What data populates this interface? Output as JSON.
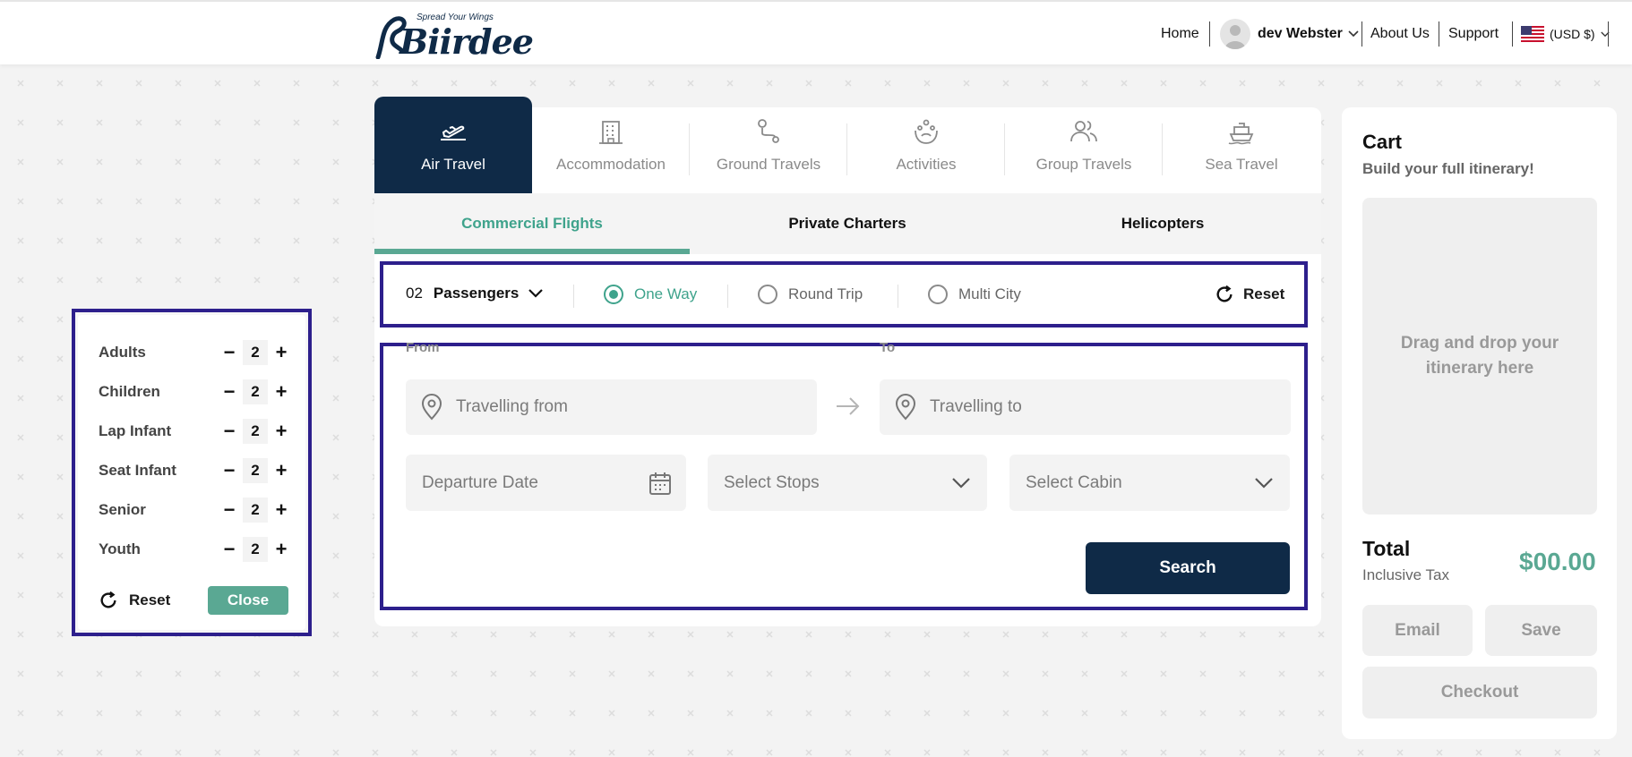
{
  "header": {
    "brand": {
      "name": "Biirdee",
      "tagline": "Spread Your Wings"
    },
    "nav": {
      "home": "Home",
      "user": "dev Webster",
      "about": "About Us",
      "support": "Support",
      "currency": "(USD $)"
    }
  },
  "tabs": [
    {
      "label": "Air Travel",
      "icon": "plane-icon",
      "active": true
    },
    {
      "label": "Accommodation",
      "icon": "building-icon",
      "active": false
    },
    {
      "label": "Ground Travels",
      "icon": "route-icon",
      "active": false
    },
    {
      "label": "Activities",
      "icon": "activities-icon",
      "active": false
    },
    {
      "label": "Group Travels",
      "icon": "group-icon",
      "active": false
    },
    {
      "label": "Sea Travel",
      "icon": "ship-icon",
      "active": false
    }
  ],
  "subtabs": [
    {
      "label": "Commercial Flights",
      "active": true
    },
    {
      "label": "Private Charters",
      "active": false
    },
    {
      "label": "Helicopters",
      "active": false
    }
  ],
  "trip": {
    "passenger_count": "02",
    "passenger_label": "Passengers",
    "options": [
      {
        "label": "One Way",
        "selected": true
      },
      {
        "label": "Round Trip",
        "selected": false
      },
      {
        "label": "Multi City",
        "selected": false
      }
    ],
    "reset": "Reset"
  },
  "form": {
    "from_label": "From",
    "to_label": "To",
    "from_placeholder": "Travelling from",
    "to_placeholder": "Travelling to",
    "departure": "Departure Date",
    "stops": "Select Stops",
    "cabin": "Select Cabin",
    "search": "Search"
  },
  "passengers_popup": {
    "rows": [
      {
        "label": "Adults",
        "value": "2"
      },
      {
        "label": "Children",
        "value": "2"
      },
      {
        "label": "Lap Infant",
        "value": "2"
      },
      {
        "label": "Seat Infant",
        "value": "2"
      },
      {
        "label": "Senior",
        "value": "2"
      },
      {
        "label": "Youth",
        "value": "2"
      }
    ],
    "reset": "Reset",
    "close": "Close"
  },
  "cart": {
    "title": "Cart",
    "subtitle": "Build your full itinerary!",
    "drop_text": "Drag and drop your itinerary here",
    "total_label": "Total",
    "tax_label": "Inclusive Tax",
    "amount": "$00.00",
    "email": "Email",
    "save": "Save",
    "checkout": "Checkout"
  },
  "colors": {
    "navy": "#0f2a47",
    "teal": "#5aa893",
    "highlight": "#2d1f8c"
  }
}
